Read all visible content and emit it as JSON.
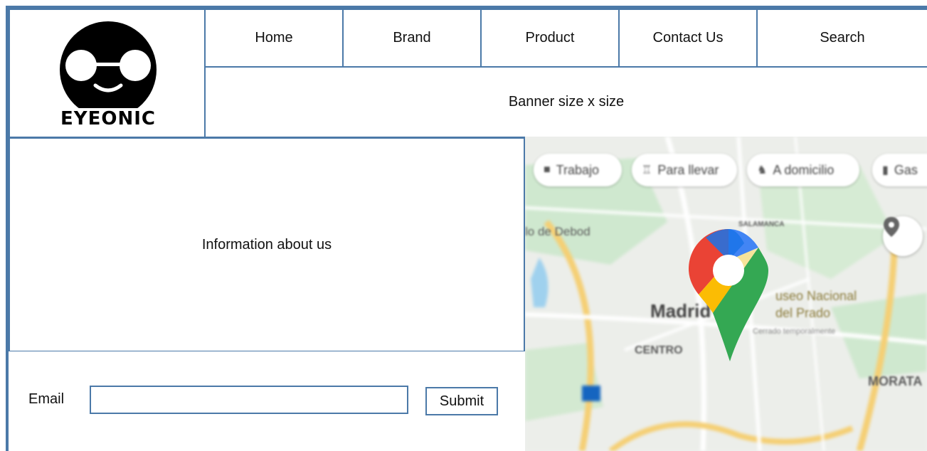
{
  "logo": {
    "text": "EYEONIC"
  },
  "nav": {
    "items": [
      {
        "label": "Home"
      },
      {
        "label": "Brand"
      },
      {
        "label": "Product"
      },
      {
        "label": "Contact Us"
      },
      {
        "label": "Search"
      }
    ]
  },
  "banner": {
    "text": "Banner size x size"
  },
  "info": {
    "text": "Information about us"
  },
  "form": {
    "email_label": "Email",
    "email_value": "",
    "submit_label": "Submit"
  },
  "map": {
    "chips": [
      {
        "label": "Trabajo",
        "icon": "briefcase-icon"
      },
      {
        "label": "Para llevar",
        "icon": "takeout-icon"
      },
      {
        "label": "A domicilio",
        "icon": "delivery-icon"
      },
      {
        "label": "Gas",
        "icon": "gas-icon"
      }
    ],
    "labels": {
      "debod": "lo de Debod",
      "salamanca": "SALAMANCA",
      "madrid": "Madrid",
      "museo": "useo Nacional",
      "prado": "del Prado",
      "cerrado": "Cerrado temporalmente",
      "centro": "CENTRO",
      "moratalaz": "MORATA"
    },
    "colors": {
      "pin_red": "#ea4335",
      "pin_blue": "#4285f4",
      "pin_yellow": "#fbbc04",
      "pin_green": "#34a853",
      "park": "#c8e6c9",
      "road": "#f6d27a"
    }
  }
}
